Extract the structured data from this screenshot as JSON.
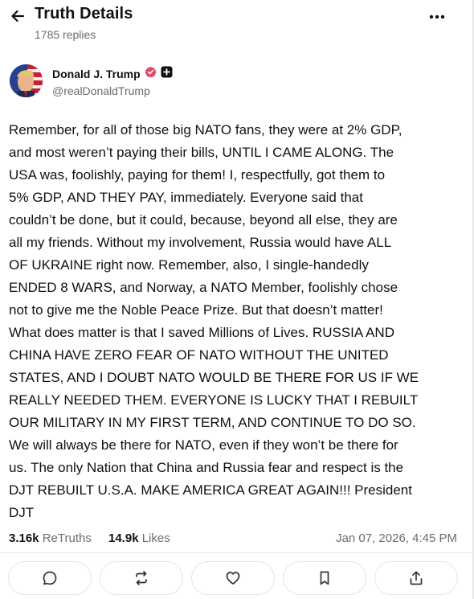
{
  "header": {
    "title": "Truth Details",
    "replies": "1785 replies"
  },
  "author": {
    "display_name": "Donald J. Trump",
    "handle": "@realDonaldTrump",
    "verified_color": "#e8456a"
  },
  "post": {
    "text": "Remember, for all of those big NATO fans, they were at 2% GDP,\nand most weren’t paying their bills, UNTIL I CAME ALONG. The\nUSA was, foolishly, paying for them! I, respectfully, got them to\n5% GDP, AND THEY PAY, immediately. Everyone said that\ncouldn’t be done, but it could, because, beyond all else, they are\nall my friends. Without my involvement, Russia would have ALL\nOF UKRAINE right now. Remember, also, I single-handedly\nENDED 8 WARS, and Norway, a NATO Member, foolishly chose\nnot to give me the Noble Peace Prize. But that doesn’t matter!\nWhat does matter is that I saved Millions of Lives. RUSSIA AND\nCHINA HAVE ZERO FEAR OF NATO WITHOUT THE UNITED\nSTATES, AND I DOUBT NATO WOULD BE THERE FOR US IF WE\nREALLY NEEDED THEM. EVERYONE IS LUCKY THAT I REBUILT\nOUR MILITARY IN MY FIRST TERM, AND CONTINUE TO DO SO.\nWe will always be there for NATO, even if they won’t be there for\nus. The only Nation that China and Russia fear and respect is the\nDJT REBUILT U.S.A. MAKE AMERICA GREAT AGAIN!!! President\nDJT"
  },
  "stats": {
    "retruths_count": "3.16k",
    "retruths_label": "ReTruths",
    "likes_count": "14.9k",
    "likes_label": "Likes",
    "timestamp": "Jan 07, 2026, 4:45 PM"
  },
  "actions": [
    {
      "icon": "reply-icon"
    },
    {
      "icon": "retruth-icon"
    },
    {
      "icon": "like-icon"
    },
    {
      "icon": "bookmark-icon"
    },
    {
      "icon": "share-icon"
    }
  ]
}
